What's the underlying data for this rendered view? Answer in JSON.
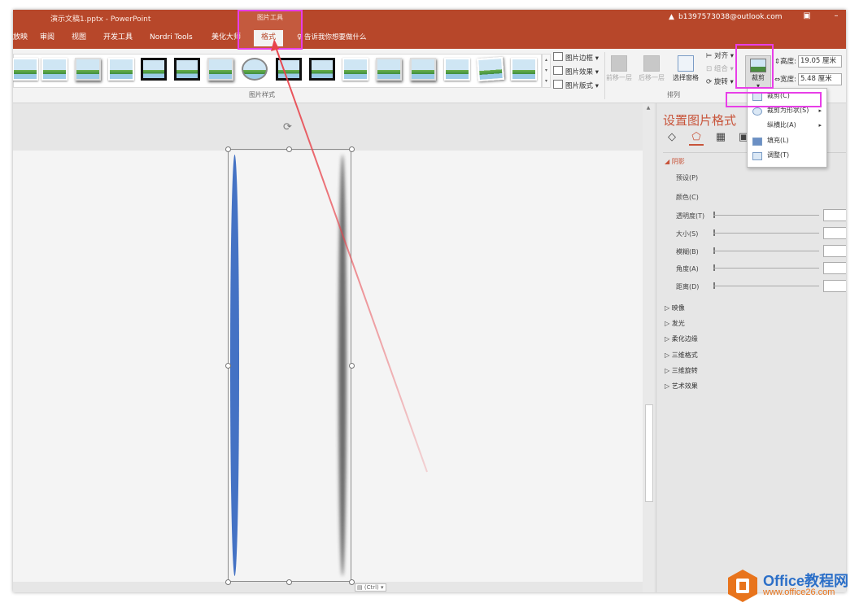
{
  "window": {
    "title": "演示文稿1.pptx  -  PowerPoint",
    "context_tab_label": "图片工具",
    "account": "b1397573038@outlook.com",
    "ribbon_display_icon": "ribbon-display-icon",
    "minimize_glyph": "–"
  },
  "tabs": [
    {
      "label": "放映"
    },
    {
      "label": "审阅"
    },
    {
      "label": "视图"
    },
    {
      "label": "开发工具"
    },
    {
      "label": "Nordri Tools"
    },
    {
      "label": "美化大师"
    },
    {
      "label": "格式"
    }
  ],
  "tell_me": "告诉我你想要做什么",
  "ribbon": {
    "gallery_commands": [
      "图片边框 ▾",
      "图片效果 ▾",
      "图片版式 ▾"
    ],
    "group_picture_styles": "图片样式",
    "group_arrange": "排列",
    "arrange_large": [
      "前移一层",
      "后移一层",
      "选择窗格"
    ],
    "arrange_small": [
      "对齐 ▾",
      "组合 ▾",
      "旋转 ▾"
    ],
    "crop_label": "裁剪",
    "crop_arrow": "▾",
    "height_label": "高度:",
    "height_value": "19.05 厘米",
    "width_label": "宽度:",
    "width_value": "5.48 厘米"
  },
  "crop_menu": [
    {
      "label": "裁剪(C)",
      "icon": "crop-icon",
      "submenu": false
    },
    {
      "label": "裁剪为形状(S)",
      "icon": "shape-icon",
      "submenu": true
    },
    {
      "label": "纵横比(A)",
      "icon": "",
      "submenu": true
    },
    {
      "label": "填充(L)",
      "icon": "fill-icon",
      "submenu": false
    },
    {
      "label": "调整(T)",
      "icon": "fit-icon",
      "submenu": false
    }
  ],
  "paste_options": "(Ctrl) ▾",
  "pane": {
    "title": "设置图片格式",
    "shadow_section": "阴影",
    "rows": [
      "预设(P)",
      "颜色(C)",
      "透明度(T)",
      "大小(S)",
      "模糊(B)",
      "角度(A)",
      "距离(D)"
    ],
    "sections": [
      "映像",
      "发光",
      "柔化边缘",
      "三维格式",
      "三维旋转",
      "艺术效果"
    ]
  },
  "watermark": {
    "name": "Office教程网",
    "url": "www.office26.com"
  },
  "colors": {
    "title_bar": "#b7472a",
    "highlight": "#e83ee8",
    "annotation_arrow": "#e8434b",
    "ellipse_fill": "#4472c4"
  }
}
